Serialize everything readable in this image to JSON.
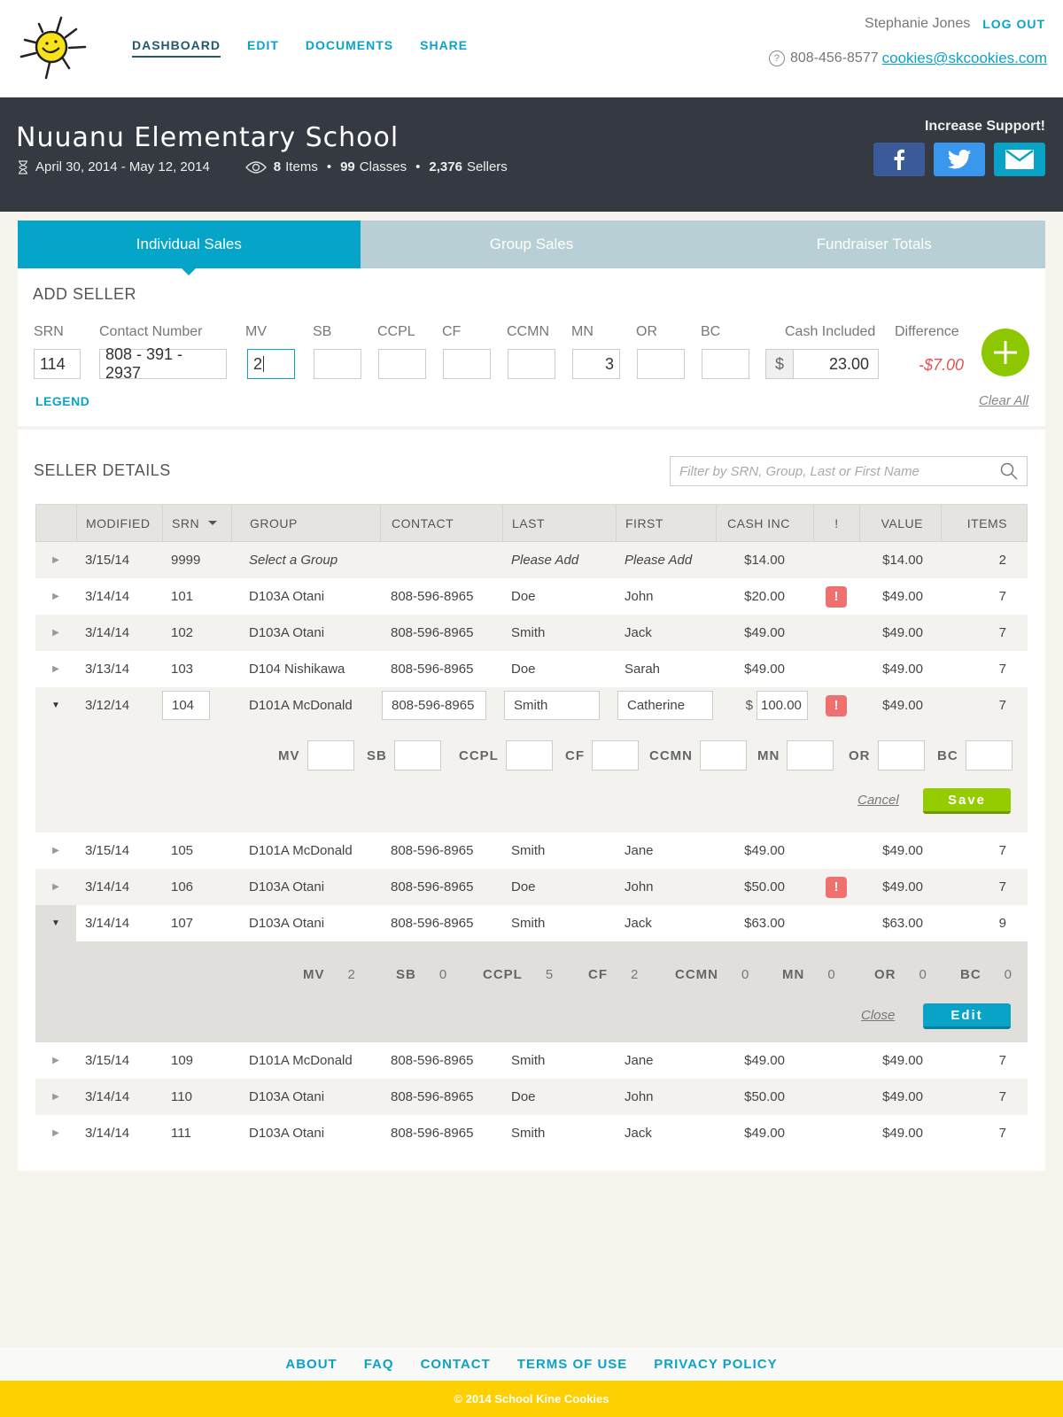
{
  "nav": {
    "items": [
      {
        "label": "DASHBOARD",
        "active": true
      },
      {
        "label": "EDIT",
        "active": false
      },
      {
        "label": "DOCUMENTS",
        "active": false
      },
      {
        "label": "SHARE",
        "active": false
      }
    ]
  },
  "user": {
    "name": "Stephanie Jones",
    "logout_label": "LOG OUT",
    "phone": "808-456-8577",
    "email": "cookies@skcookies.com"
  },
  "banner": {
    "school_name": "Nuuanu Elementary School",
    "date_range": "April 30, 2014 - May 12, 2014",
    "items_count": "8",
    "items_label": "Items",
    "classes_count": "99",
    "classes_label": "Classes",
    "sellers_count": "2,376",
    "sellers_label": "Sellers",
    "support_label": "Increase Support!"
  },
  "tabs": [
    {
      "label": "Individual Sales",
      "active": true
    },
    {
      "label": "Group Sales",
      "active": false
    },
    {
      "label": "Fundraiser Totals",
      "active": false
    }
  ],
  "add_seller": {
    "title": "ADD SELLER",
    "fields": {
      "srn": {
        "label": "SRN",
        "value": "114"
      },
      "contact": {
        "label": "Contact Number",
        "value": "808 - 391 - 2937"
      },
      "mv": {
        "label": "MV",
        "value": "2"
      },
      "sb": {
        "label": "SB",
        "value": ""
      },
      "ccpl": {
        "label": "CCPL",
        "value": ""
      },
      "cf": {
        "label": "CF",
        "value": ""
      },
      "ccmn": {
        "label": "CCMN",
        "value": ""
      },
      "mn": {
        "label": "MN",
        "value": "3"
      },
      "or": {
        "label": "OR",
        "value": ""
      },
      "bc": {
        "label": "BC",
        "value": ""
      },
      "cash": {
        "label": "Cash Included",
        "currency": "$",
        "value": "23.00"
      }
    },
    "difference_label": "Difference",
    "difference_value": "-$7.00",
    "legend_label": "LEGEND",
    "clear_all_label": "Clear All"
  },
  "seller_details": {
    "title": "SELLER DETAILS",
    "search_placeholder": "Filter by SRN, Group, Last or First Name",
    "columns": [
      "",
      "MODIFIED",
      "SRN",
      "GROUP",
      "CONTACT",
      "LAST",
      "FIRST",
      "CASH INC",
      "!",
      "VALUE",
      "ITEMS"
    ],
    "rows": [
      {
        "modified": "3/15/14",
        "srn": "9999",
        "group": "Select a Group",
        "contact": "",
        "last": "Please Add",
        "first": "Please Add",
        "cash": "$14.00",
        "alert": false,
        "value": "$14.00",
        "items": "2"
      },
      {
        "modified": "3/14/14",
        "srn": "101",
        "group": "D103A Otani",
        "contact": "808-596-8965",
        "last": "Doe",
        "first": "John",
        "cash": "$20.00",
        "alert": true,
        "value": "$49.00",
        "items": "7"
      },
      {
        "modified": "3/14/14",
        "srn": "102",
        "group": "D103A Otani",
        "contact": "808-596-8965",
        "last": "Smith",
        "first": "Jack",
        "cash": "$49.00",
        "alert": false,
        "value": "$49.00",
        "items": "7"
      },
      {
        "modified": "3/13/14",
        "srn": "103",
        "group": "D104 Nishikawa",
        "contact": "808-596-8965",
        "last": "Doe",
        "first": "Sarah",
        "cash": "$49.00",
        "alert": false,
        "value": "$49.00",
        "items": "7"
      },
      {
        "modified": "3/12/14",
        "srn": "104",
        "group": "D101A McDonald",
        "contact": "808-596-8965",
        "last": "Smith",
        "first": "Catherine",
        "cash_currency": "$",
        "cash": "100.00",
        "alert": true,
        "value": "$49.00",
        "items": "7"
      },
      {
        "modified": "3/15/14",
        "srn": "105",
        "group": "D101A McDonald",
        "contact": "808-596-8965",
        "last": "Smith",
        "first": "Jane",
        "cash": "$49.00",
        "alert": false,
        "value": "$49.00",
        "items": "7"
      },
      {
        "modified": "3/14/14",
        "srn": "106",
        "group": "D103A Otani",
        "contact": "808-596-8965",
        "last": "Doe",
        "first": "John",
        "cash": "$50.00",
        "alert": true,
        "value": "$49.00",
        "items": "7"
      },
      {
        "modified": "3/14/14",
        "srn": "107",
        "group": "D103A Otani",
        "contact": "808-596-8965",
        "last": "Smith",
        "first": "Jack",
        "cash": "$63.00",
        "alert": false,
        "value": "$63.00",
        "items": "9"
      },
      {
        "modified": "3/15/14",
        "srn": "109",
        "group": "D101A McDonald",
        "contact": "808-596-8965",
        "last": "Smith",
        "first": "Jane",
        "cash": "$49.00",
        "alert": false,
        "value": "$49.00",
        "items": "7"
      },
      {
        "modified": "3/14/14",
        "srn": "110",
        "group": "D103A Otani",
        "contact": "808-596-8965",
        "last": "Doe",
        "first": "John",
        "cash": "$50.00",
        "alert": false,
        "value": "$49.00",
        "items": "7"
      },
      {
        "modified": "3/14/14",
        "srn": "111",
        "group": "D103A Otani",
        "contact": "808-596-8965",
        "last": "Smith",
        "first": "Jack",
        "cash": "$49.00",
        "alert": false,
        "value": "$49.00",
        "items": "7"
      }
    ],
    "edit_panel": {
      "labels": [
        "MV",
        "SB",
        "CCPL",
        "CF",
        "CCMN",
        "MN",
        "OR",
        "BC"
      ],
      "cancel_label": "Cancel",
      "save_label": "Save"
    },
    "view_panel": {
      "items": [
        {
          "label": "MV",
          "value": "2"
        },
        {
          "label": "SB",
          "value": "0"
        },
        {
          "label": "CCPL",
          "value": "5"
        },
        {
          "label": "CF",
          "value": "2"
        },
        {
          "label": "CCMN",
          "value": "0"
        },
        {
          "label": "MN",
          "value": "0"
        },
        {
          "label": "OR",
          "value": "0"
        },
        {
          "label": "BC",
          "value": "0"
        }
      ],
      "close_label": "Close",
      "edit_label": "Edit"
    }
  },
  "footer": {
    "links": [
      "ABOUT",
      "FAQ",
      "CONTACT",
      "TERMS OF USE",
      "PRIVACY POLICY"
    ],
    "copyright": "© 2014 School Kine Cookies"
  },
  "colors": {
    "brand_blue": "#05a5ca",
    "banner_dark": "#353a42",
    "alert_red": "#f07070",
    "save_green": "#94cc00",
    "footer_yellow": "#ffd000"
  }
}
